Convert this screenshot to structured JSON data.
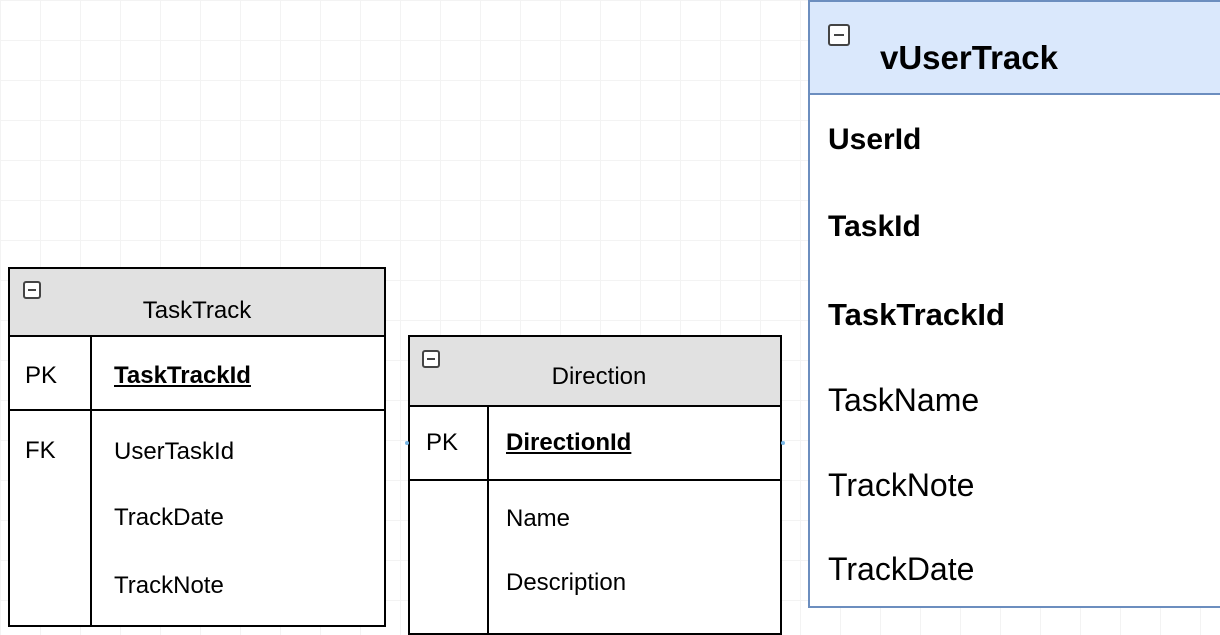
{
  "entities": {
    "tasktrack": {
      "title": "TaskTrack",
      "rows": [
        {
          "key": "PK",
          "name": "TaskTrackId"
        },
        {
          "key": "FK",
          "name": "UserTaskId"
        },
        {
          "key": "",
          "name": "TrackDate"
        },
        {
          "key": "",
          "name": "TrackNote"
        }
      ]
    },
    "direction": {
      "title": "Direction",
      "rows": [
        {
          "key": "PK",
          "name": "DirectionId"
        },
        {
          "key": "",
          "name": "Name"
        },
        {
          "key": "",
          "name": "Description"
        }
      ]
    },
    "vusertrack": {
      "title": "vUserTrack",
      "fields": [
        "UserId",
        "TaskId",
        "TaskTrackId",
        "TaskName",
        "TrackNote",
        "TrackDate"
      ]
    }
  },
  "icons": {
    "collapse": "minus-square-icon"
  },
  "colors": {
    "table_header": "#e1e1e1",
    "table_border": "#000000",
    "view_header": "#dae8fc",
    "view_border": "#6c8ebf",
    "connection_handle": "#7ab8e6"
  }
}
